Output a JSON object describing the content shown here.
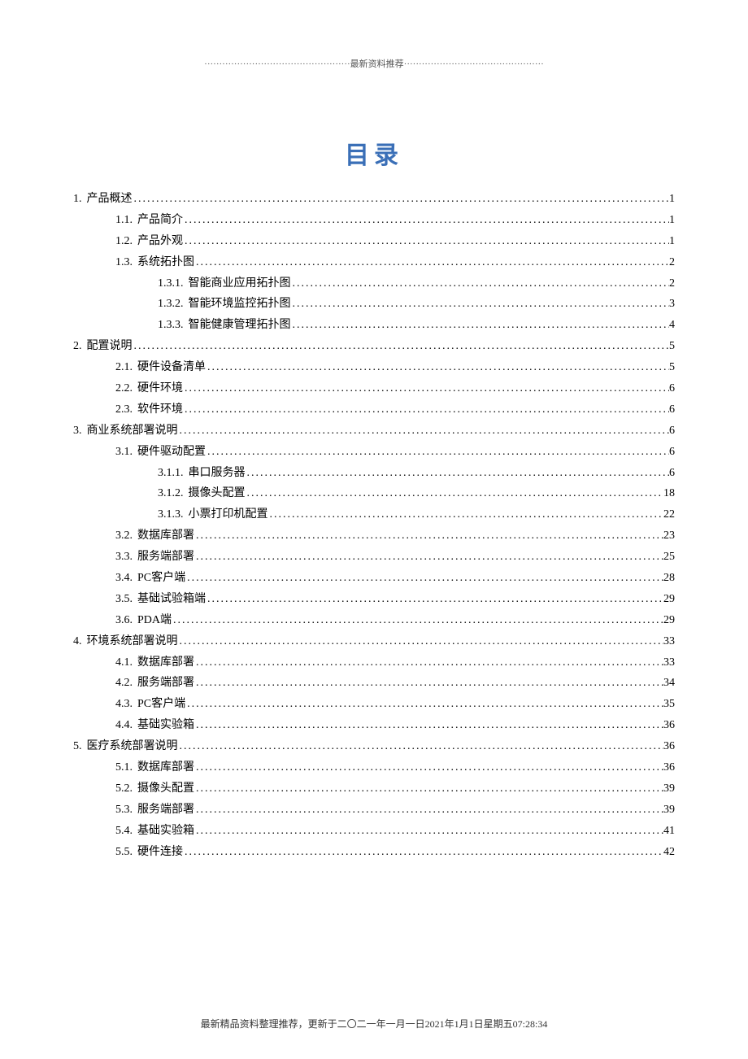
{
  "header_text": "·················································最新资料推荐···············································",
  "title": "目录",
  "leader_char": "........................................................................................................................................................................................................",
  "footer": "最新精品资料整理推荐，更新于二〇二一年一月一日2021年1月1日星期五07:28:34",
  "toc": [
    {
      "level": 0,
      "num": "1.",
      "label": "产品概述",
      "page": "1"
    },
    {
      "level": 1,
      "num": "1.1.",
      "label": "产品简介",
      "page": "1"
    },
    {
      "level": 1,
      "num": "1.2.",
      "label": "产品外观",
      "page": "1"
    },
    {
      "level": 1,
      "num": "1.3.",
      "label": "系统拓扑图",
      "page": "2"
    },
    {
      "level": 2,
      "num": "1.3.1.",
      "label": "智能商业应用拓扑图",
      "page": "2"
    },
    {
      "level": 2,
      "num": "1.3.2.",
      "label": "智能环境监控拓扑图",
      "page": "3"
    },
    {
      "level": 2,
      "num": "1.3.3.",
      "label": "智能健康管理拓扑图",
      "page": "4"
    },
    {
      "level": 0,
      "num": "2.",
      "label": "配置说明",
      "page": "5"
    },
    {
      "level": 1,
      "num": "2.1.",
      "label": "硬件设备清单",
      "page": "5"
    },
    {
      "level": 1,
      "num": "2.2.",
      "label": "硬件环境",
      "page": "6"
    },
    {
      "level": 1,
      "num": "2.3.",
      "label": "软件环境",
      "page": "6"
    },
    {
      "level": 0,
      "num": "3.",
      "label": "商业系统部署说明",
      "page": "6"
    },
    {
      "level": 1,
      "num": "3.1.",
      "label": "硬件驱动配置",
      "page": "6"
    },
    {
      "level": 2,
      "num": "3.1.1.",
      "label": "串口服务器",
      "page": "6"
    },
    {
      "level": 2,
      "num": "3.1.2.",
      "label": "摄像头配置",
      "page": "18"
    },
    {
      "level": 2,
      "num": "3.1.3.",
      "label": "小票打印机配置",
      "page": "22"
    },
    {
      "level": 1,
      "num": "3.2.",
      "label": "数据库部署",
      "page": "23"
    },
    {
      "level": 1,
      "num": "3.3.",
      "label": "服务端部署",
      "page": "25"
    },
    {
      "level": 1,
      "num": "3.4.",
      "label": "PC客户端",
      "page": "28"
    },
    {
      "level": 1,
      "num": "3.5.",
      "label": "基础试验箱端",
      "page": "29"
    },
    {
      "level": 1,
      "num": "3.6.",
      "label": "PDA端",
      "page": "29"
    },
    {
      "level": 0,
      "num": "4.",
      "label": "环境系统部署说明",
      "page": "33"
    },
    {
      "level": 1,
      "num": "4.1.",
      "label": "数据库部署",
      "page": "33"
    },
    {
      "level": 1,
      "num": "4.2.",
      "label": "服务端部署",
      "page": "34"
    },
    {
      "level": 1,
      "num": "4.3.",
      "label": "PC客户端",
      "page": "35"
    },
    {
      "level": 1,
      "num": "4.4.",
      "label": "基础实验箱",
      "page": "36"
    },
    {
      "level": 0,
      "num": "5.",
      "label": "医疗系统部署说明",
      "page": "36"
    },
    {
      "level": 1,
      "num": "5.1.",
      "label": "数据库部署",
      "page": "36"
    },
    {
      "level": 1,
      "num": "5.2.",
      "label": "摄像头配置",
      "page": "39"
    },
    {
      "level": 1,
      "num": "5.3.",
      "label": "服务端部署",
      "page": "39"
    },
    {
      "level": 1,
      "num": "5.4.",
      "label": "基础实验箱",
      "page": "41"
    },
    {
      "level": 1,
      "num": "5.5.",
      "label": "硬件连接",
      "page": "42"
    }
  ]
}
